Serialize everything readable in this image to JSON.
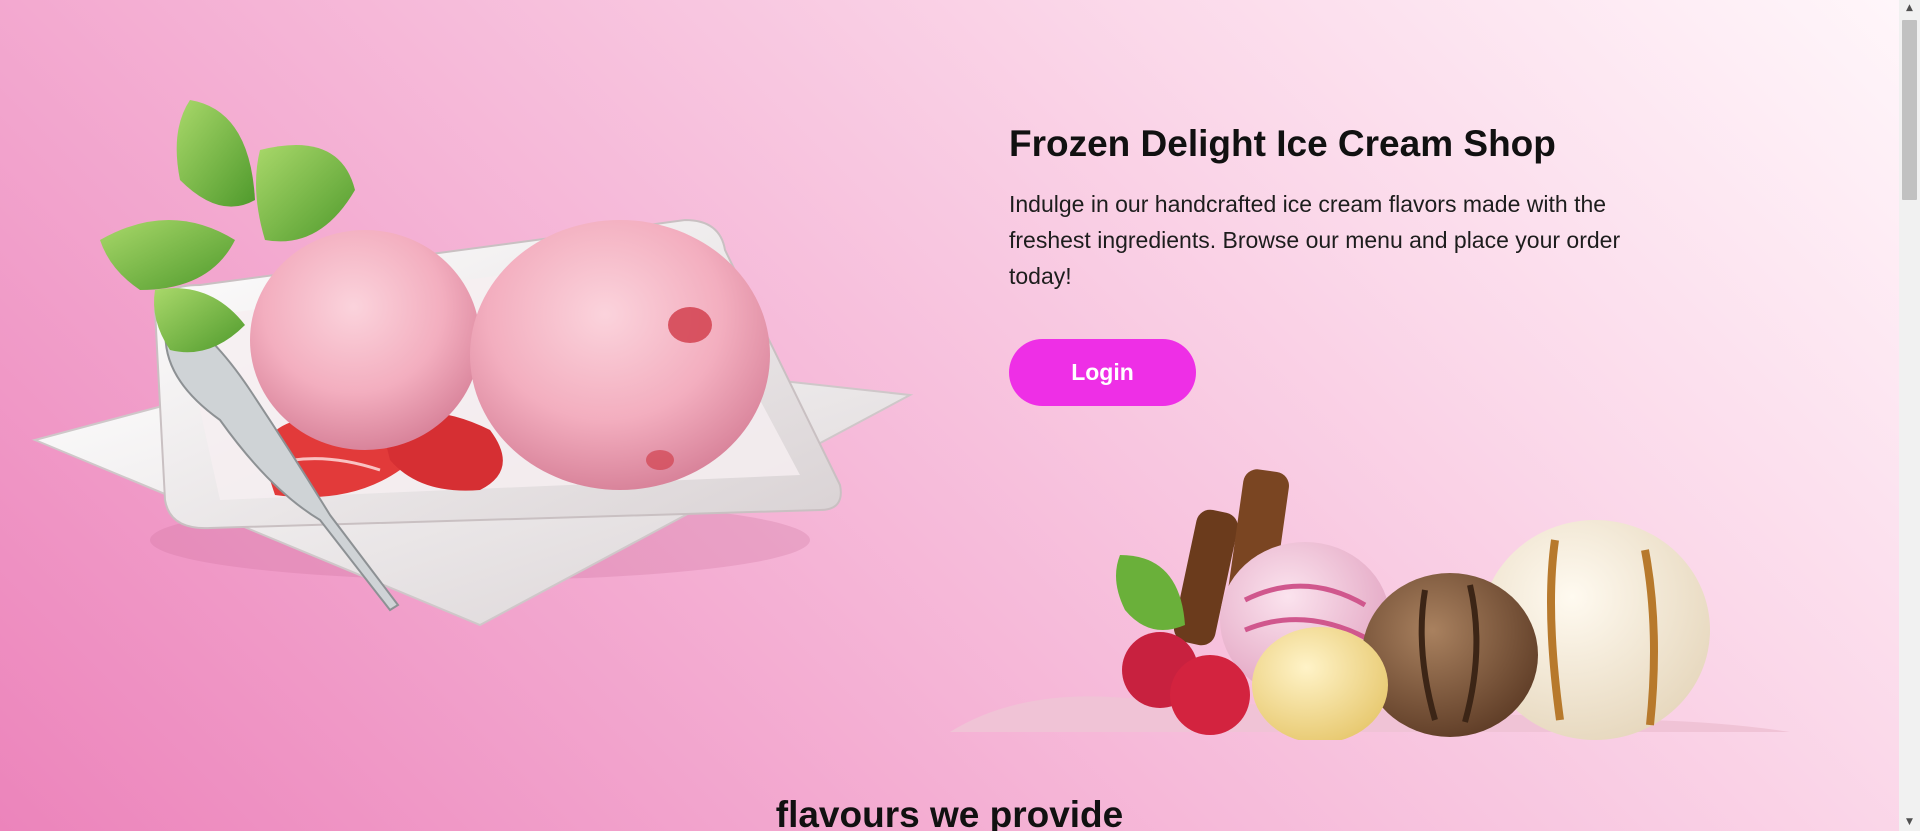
{
  "hero": {
    "title": "Frozen Delight Ice Cream Shop",
    "description": "Indulge in our handcrafted ice cream flavors made with the freshest ingredients. Browse our menu and place your order today!",
    "login_label": "Login"
  },
  "sections": {
    "flavours_heading": "flavours we provide"
  },
  "colors": {
    "accent": "#ee2fe6",
    "background_light": "#fff6fa",
    "background_dark": "#ec84bb"
  },
  "icons": {
    "scroll_up": "scroll-up-arrow-icon",
    "scroll_down": "scroll-down-arrow-icon"
  }
}
